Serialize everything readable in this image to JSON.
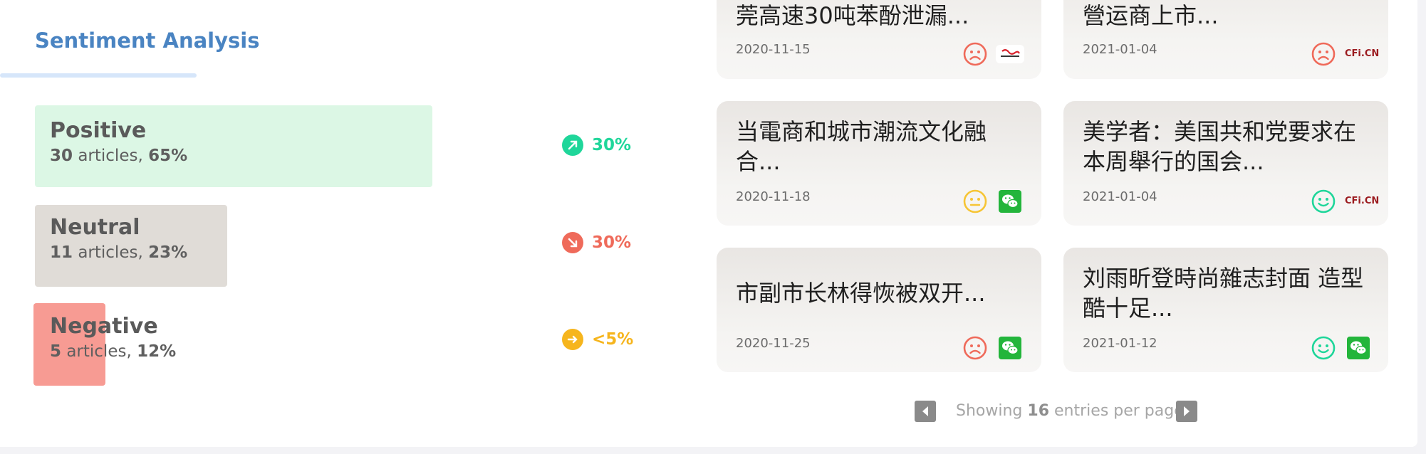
{
  "sentiment": {
    "title": "Sentiment Analysis",
    "rows": [
      {
        "label": "Positive",
        "count": "30",
        "articles_word": "articles",
        "pct": "65%",
        "trend": "30%",
        "trend_dir": "up",
        "color": "#dcf7e5",
        "trend_color": "#1fd69a"
      },
      {
        "label": "Neutral",
        "count": "11",
        "articles_word": "articles",
        "pct": "23%",
        "trend": "30%",
        "trend_dir": "down",
        "color": "#e0dcd7",
        "trend_color": "#ef6a5a"
      },
      {
        "label": "Negative",
        "count": "5",
        "articles_word": "articles",
        "pct": "12%",
        "trend": "<5%",
        "trend_dir": "flat",
        "color": "#f79b93",
        "trend_color": "#f6b51d"
      }
    ]
  },
  "news": [
    {
      "title": "莞高速30吨苯酚泄漏...",
      "date": "2020-11-15",
      "sentiment": "negative",
      "source": "sohu-logo"
    },
    {
      "title": "營运商上市...",
      "date": "2021-01-04",
      "sentiment": "negative",
      "source": "cfi-logo",
      "source_text": "CFi.CN"
    },
    {
      "title": "当電商和城市潮流文化融合...",
      "date": "2020-11-18",
      "sentiment": "neutral",
      "source": "wechat-icon"
    },
    {
      "title": "美学者：美国共和党要求在本周舉行的国会...",
      "date": "2021-01-04",
      "sentiment": "positive",
      "source": "cfi-logo",
      "source_text": "CFi.CN"
    },
    {
      "title": "市副市长林得恢被双开...",
      "date": "2020-11-25",
      "sentiment": "negative",
      "source": "wechat-icon"
    },
    {
      "title": "刘雨昕登時尚雜志封面 造型酷十足...",
      "date": "2021-01-12",
      "sentiment": "positive",
      "source": "wechat-icon"
    }
  ],
  "pager": {
    "prefix": "Showing",
    "count": "16",
    "suffix": "entries per page"
  },
  "colors": {
    "accent": "#4a84c2",
    "positive": "#1fd69a",
    "neutral": "#f6c536",
    "negative": "#ef6a5a",
    "wechat": "#23b53b"
  }
}
